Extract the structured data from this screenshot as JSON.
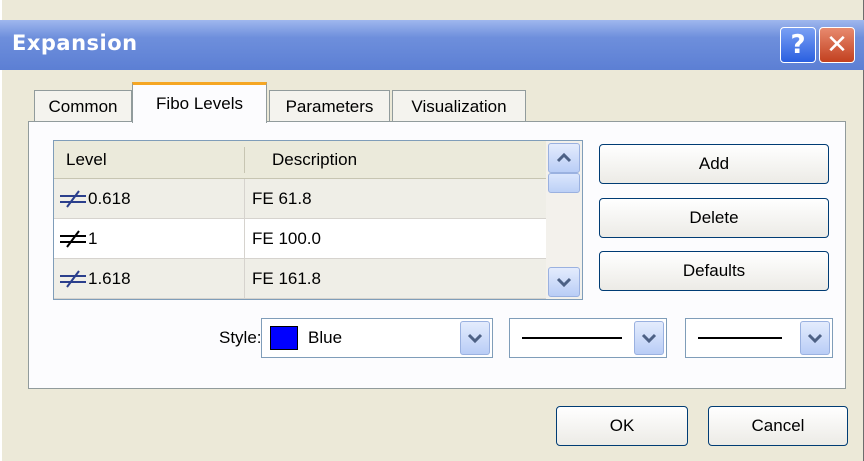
{
  "window": {
    "title": "Expansion",
    "help_glyph": "?",
    "close_glyph": "✕",
    "titlebar_color": "#6e8fdc"
  },
  "tabs": [
    {
      "label": "Common",
      "active": false
    },
    {
      "label": "Fibo Levels",
      "active": true
    },
    {
      "label": "Parameters",
      "active": false
    },
    {
      "label": "Visualization",
      "active": false
    }
  ],
  "levels_table": {
    "columns": [
      "Level",
      "Description"
    ],
    "rows": [
      {
        "icon": "fibo-level-icon",
        "level": "0.618",
        "description": "FE 61.8"
      },
      {
        "icon": "fibo-level-icon",
        "level": "1",
        "description": "FE 100.0"
      },
      {
        "icon": "fibo-level-icon",
        "level": "1.618",
        "description": "FE 161.8"
      }
    ]
  },
  "side_buttons": {
    "add": "Add",
    "delete": "Delete",
    "defaults": "Defaults"
  },
  "style": {
    "label": "Style:",
    "color_name": "Blue",
    "color_hex": "#0000ff",
    "line_style": "solid",
    "line_width": "thin"
  },
  "footer": {
    "ok": "OK",
    "cancel": "Cancel"
  }
}
